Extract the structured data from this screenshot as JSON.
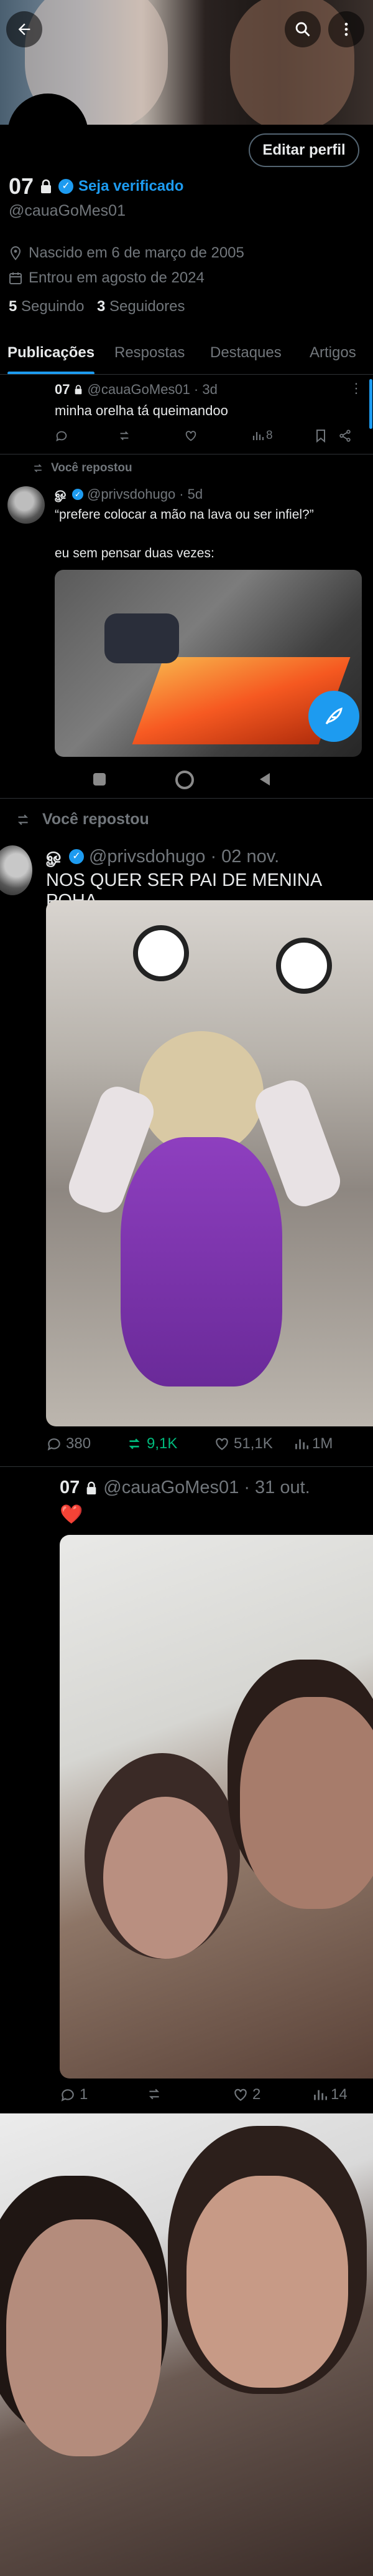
{
  "header": {
    "edit_profile_label": "Editar perfil"
  },
  "profile": {
    "name": "07",
    "verify_label": "Seja verificado",
    "handle": "@cauaGoMes01",
    "birth": "Nascido em 6 de março de 2005",
    "joined": "Entrou em agosto de 2024",
    "following_count": "5",
    "following_label": "Seguindo",
    "followers_count": "3",
    "followers_label": "Seguidores"
  },
  "tabs": [
    "Publicações",
    "Respostas",
    "Destaques",
    "Artigos"
  ],
  "post1": {
    "name": "07",
    "handle": "@cauaGoMes01",
    "time": "· 3d",
    "text": "minha orelha tá queimandoo",
    "views": "8"
  },
  "repost1": {
    "label": "Você repostou",
    "handle": "@privsdohugo",
    "time": "· 5d",
    "text1": "“prefere colocar a mão na lava ou ser infiel?”",
    "text2": "eu sem pensar duas vezes:"
  },
  "repost2": {
    "label": "Você repostou",
    "handle": "@privsdohugo",
    "time": "· 02 nov.",
    "text": "NOS QUER SER PAI DE MENINA POHA",
    "replies": "380",
    "reposts": "9,1K",
    "likes": "51,1K",
    "views": "1M"
  },
  "post2": {
    "name": "07",
    "handle": "@cauaGoMes01",
    "time": "· 31 out.",
    "text": "❤️",
    "replies": "1",
    "likes": "2",
    "views": "14"
  },
  "colors": {
    "accent": "#1d9bf0",
    "repost_green": "#00ba7c",
    "like_red": "#f91880",
    "muted": "#71767b"
  }
}
